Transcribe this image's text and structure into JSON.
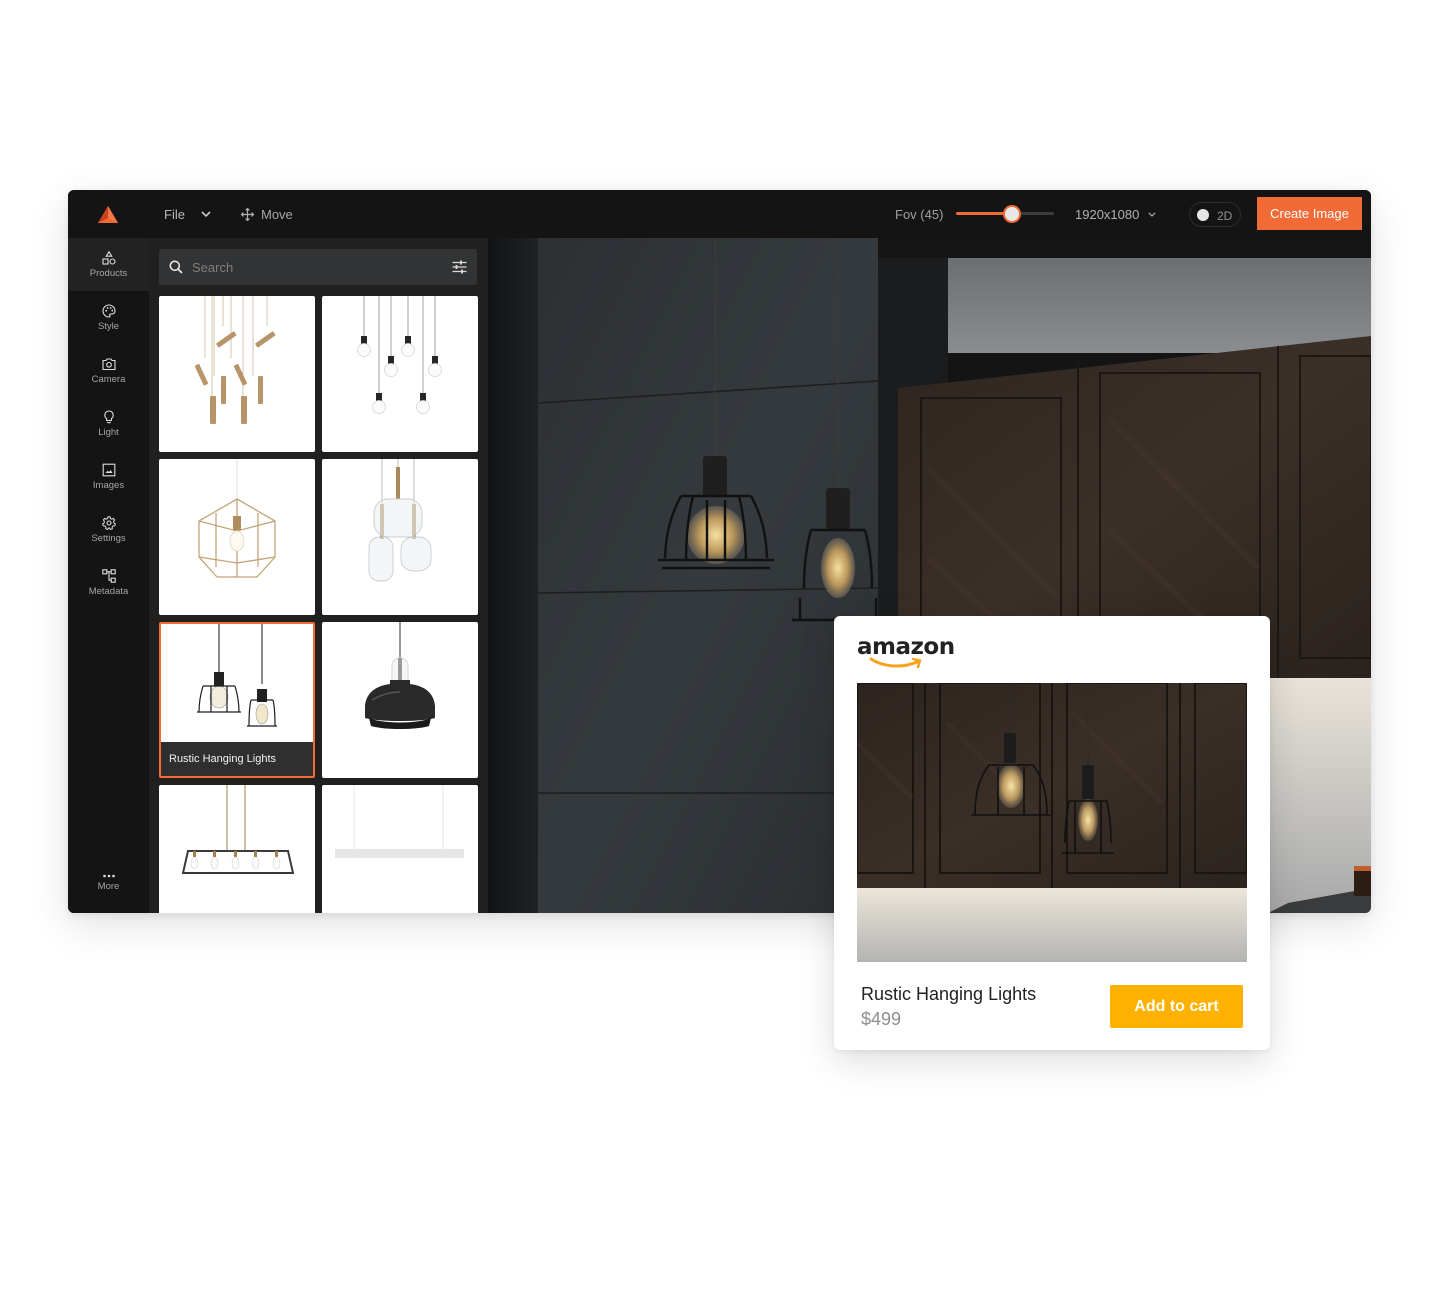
{
  "topbar": {
    "file_label": "File",
    "move_label": "Move",
    "fov_label": "Fov (45)",
    "fov_slider_value": 0.57,
    "resolution": "1920x1080",
    "mode_toggle_label": "2D",
    "create_button": "Create Image"
  },
  "colors": {
    "accent": "#f26b36",
    "cart_button": "#ffb100",
    "app_background": "#141414"
  },
  "rail": {
    "items": [
      {
        "label": "Products",
        "icon": "shapes-icon",
        "active": true
      },
      {
        "label": "Style",
        "icon": "palette-icon",
        "active": false
      },
      {
        "label": "Camera",
        "icon": "camera-icon",
        "active": false
      },
      {
        "label": "Light",
        "icon": "lightbulb-icon",
        "active": false
      },
      {
        "label": "Images",
        "icon": "image-icon",
        "active": false
      },
      {
        "label": "Settings",
        "icon": "gear-icon",
        "active": false
      },
      {
        "label": "Metadata",
        "icon": "hierarchy-icon",
        "active": false
      }
    ],
    "more_label": "More"
  },
  "panel": {
    "search_placeholder": "Search",
    "products": [
      {
        "id": "brass-spot-cluster",
        "caption": null,
        "selected": false
      },
      {
        "id": "bare-bulb-cluster",
        "caption": null,
        "selected": false
      },
      {
        "id": "geometric-brass-cage",
        "caption": null,
        "selected": false
      },
      {
        "id": "glass-globe-trio",
        "caption": null,
        "selected": false
      },
      {
        "id": "rustic-hanging-lights",
        "caption": "Rustic Hanging Lights",
        "selected": true
      },
      {
        "id": "black-dome-pendant",
        "caption": null,
        "selected": false
      },
      {
        "id": "linear-cage-chandelier",
        "caption": null,
        "selected": false
      },
      {
        "id": "white-linear-bar",
        "caption": null,
        "selected": false
      }
    ]
  },
  "card": {
    "brand": "amazon",
    "product_name": "Rustic Hanging Lights",
    "price": "$499",
    "cart_button": "Add to cart"
  }
}
